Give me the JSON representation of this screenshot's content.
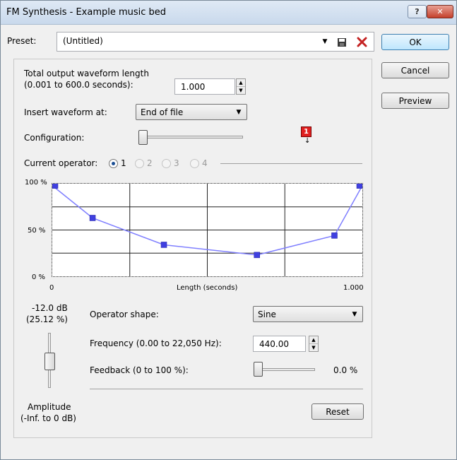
{
  "window": {
    "title": "FM Synthesis - Example music bed",
    "help_label": "?",
    "close_label": "✕"
  },
  "preset": {
    "label": "Preset:",
    "value": "(Untitled)",
    "save_icon": "save-icon",
    "delete_icon": "delete-icon"
  },
  "buttons": {
    "ok": "OK",
    "cancel": "Cancel",
    "preview": "Preview",
    "reset": "Reset"
  },
  "length": {
    "label_line1": "Total output waveform length",
    "label_line2": "(0.001 to 600.0 seconds):",
    "value": "1.000"
  },
  "insert": {
    "label": "Insert waveform at:",
    "value": "End of file"
  },
  "configuration": {
    "label": "Configuration:",
    "marker_number": "1"
  },
  "operator": {
    "label": "Current operator:",
    "options": [
      "1",
      "2",
      "3",
      "4"
    ],
    "selected": "1"
  },
  "envelope": {
    "y_ticks": [
      "100 %",
      "50 %",
      "0 %"
    ],
    "x_tick_start": "0",
    "x_tick_end": "1.000",
    "x_label": "Length (seconds)",
    "points": [
      {
        "t": 0.0,
        "level": 98
      },
      {
        "t": 0.13,
        "level": 63
      },
      {
        "t": 0.36,
        "level": 34
      },
      {
        "t": 0.66,
        "level": 23
      },
      {
        "t": 0.91,
        "level": 44
      },
      {
        "t": 1.0,
        "level": 98
      }
    ],
    "line_color": "#8080ff",
    "point_color": "#4040e0"
  },
  "amplitude": {
    "db_value": "-12.0 dB",
    "pct_value": "(25.12 %)",
    "label_line1": "Amplitude",
    "label_line2": "(-Inf. to 0 dB)",
    "level_fraction": 0.25
  },
  "operator_shape": {
    "label": "Operator shape:",
    "value": "Sine"
  },
  "frequency": {
    "label": "Frequency (0.00 to 22,050 Hz):",
    "value": "440.00"
  },
  "feedback": {
    "label": "Feedback (0 to 100 %):",
    "value": "0.0 %",
    "level_fraction": 0.0
  }
}
